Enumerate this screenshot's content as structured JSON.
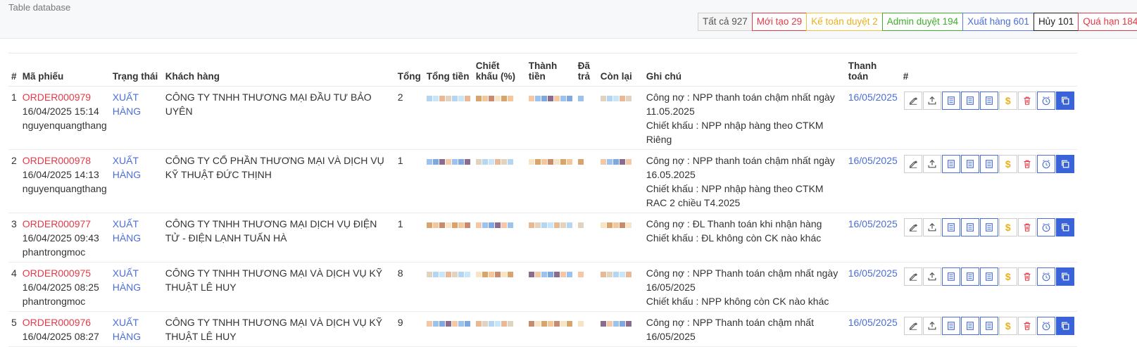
{
  "breadcrumb": "Table database",
  "filters": [
    {
      "label": "Tất cả 927"
    },
    {
      "label": "Mới tạo 29"
    },
    {
      "label": "Kế toán duyệt 2"
    },
    {
      "label": "Admin duyệt 194"
    },
    {
      "label": "Xuất hàng 601"
    },
    {
      "label": "Hủy 101"
    },
    {
      "label": "Quá hạn 184"
    }
  ],
  "columns": {
    "num": "#",
    "code": "Mã phiếu",
    "status": "Trạng thái",
    "customer": "Khách hàng",
    "qty": "Tổng",
    "total": "Tổng tiền",
    "discount": "Chiết khấu (%)",
    "net": "Thành tiền",
    "paid": "Đã trả",
    "remaining": "Còn lại",
    "note": "Ghi chú",
    "payment": "Thanh toán",
    "actions": "#"
  },
  "rows": [
    {
      "num": "1",
      "code": "ORDER000979",
      "date": "16/04/2025 15:14",
      "user": "nguyenquangthang",
      "status": "XUẤT HÀNG",
      "customer": "CÔNG TY TNHH THƯƠNG MẠI ĐẦU TƯ BẢO UYÊN",
      "qty": "2",
      "note1": "Công nợ : NPP thanh toán chậm nhất ngày 11.05.2025",
      "note2": "Chiết khấu : NPP nhập hàng theo CTKM Riêng",
      "payment": "16/05/2025"
    },
    {
      "num": "2",
      "code": "ORDER000978",
      "date": "16/04/2025 14:13",
      "user": "nguyenquangthang",
      "status": "XUẤT HÀNG",
      "customer": "CÔNG TY CỔ PHẦN THƯƠNG MẠI VÀ DỊCH VỤ KỸ THUẬT ĐỨC THỊNH",
      "qty": "1",
      "note1": "Công nợ : NPP thanh toán chậm nhất ngày 16.05.2025",
      "note2": "Chiết khấu : NPP nhập hàng theo CTKM RAC 2 chiều T4.2025",
      "payment": "16/05/2025"
    },
    {
      "num": "3",
      "code": "ORDER000977",
      "date": "16/04/2025 09:43",
      "user": "phantrongmoc",
      "status": "XUẤT HÀNG",
      "customer": "CÔNG TY TNHH THƯƠNG MẠI DỊCH VỤ ĐIỆN TỬ - ĐIỆN LẠNH TUẤN HÀ",
      "qty": "1",
      "note1": "Công nợ : ĐL Thanh toán khi nhận hàng",
      "note2": "Chiết khấu : ĐL không còn CK nào khác",
      "payment": "16/05/2025"
    },
    {
      "num": "4",
      "code": "ORDER000975",
      "date": "16/04/2025 08:25",
      "user": "phantrongmoc",
      "status": "XUẤT HÀNG",
      "customer": "CÔNG TY TNHH THƯƠNG MẠI VÀ DỊCH VỤ KỸ THUẬT LÊ HUY",
      "qty": "8",
      "note1": "Công nợ : NPP Thanh toán chậm nhất ngày 16/05/2025",
      "note2": "Chiết khấu : NPP không còn CK nào khác",
      "payment": "16/05/2025"
    },
    {
      "num": "5",
      "code": "ORDER000976",
      "date": "16/04/2025 08:27",
      "user": "",
      "status": "XUẤT HÀNG",
      "customer": "CÔNG TY TNHH THƯƠNG MẠI VÀ DỊCH VỤ KỸ THUẬT LÊ HUY",
      "qty": "9",
      "note1": "Công nợ : NPP Thanh toán chậm nhất 16/05/2025",
      "note2": "",
      "payment": "16/05/2025"
    }
  ],
  "action_icons": [
    "edit-icon",
    "upload-icon",
    "document-icon",
    "document-icon",
    "document-icon",
    "dollar-icon",
    "trash-icon",
    "clock-icon",
    "copy-icon"
  ],
  "colors": {
    "accent": "#4a6fd8",
    "danger": "#e63946",
    "warning": "#e8b21a",
    "success": "#3fae2a"
  }
}
